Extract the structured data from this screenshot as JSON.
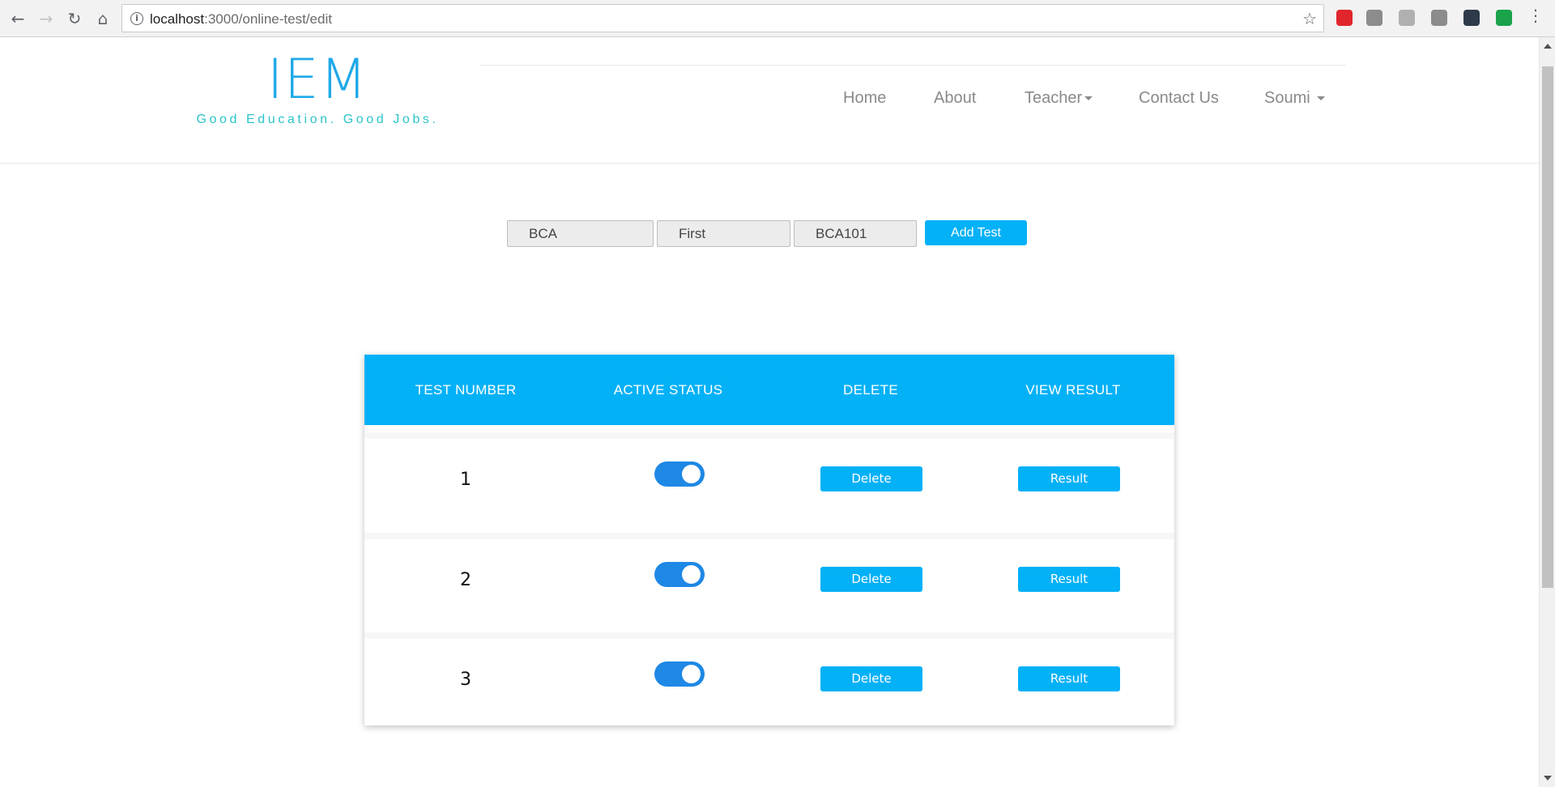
{
  "browser": {
    "url_host": "localhost",
    "url_path": ":3000/online-test/edit",
    "back_icon": "arrow-left-icon",
    "forward_icon": "arrow-right-icon",
    "reload_icon": "reload-icon",
    "home_icon": "home-icon",
    "extension_colors": [
      "#e0262b",
      "#8c8c8c",
      "#b0b0b0",
      "#8c8c8c",
      "#2e3a4a",
      "#1aa34a"
    ]
  },
  "header": {
    "brand": "IEM",
    "tagline": "Good Education. Good Jobs.",
    "nav": [
      {
        "label": "Home",
        "dropdown": false
      },
      {
        "label": "About",
        "dropdown": false
      },
      {
        "label": "Teacher",
        "dropdown": true
      },
      {
        "label": "Contact Us",
        "dropdown": false
      },
      {
        "label": "Soumi",
        "dropdown": true
      }
    ]
  },
  "form": {
    "course": "BCA",
    "semester": "First",
    "subject": "BCA101",
    "add_label": "Add Test"
  },
  "table": {
    "headers": [
      "TEST NUMBER",
      "ACTIVE STATUS",
      "DELETE",
      "VIEW RESULT"
    ],
    "rows": [
      {
        "number": "1",
        "active": true,
        "delete_label": "Delete",
        "result_label": "Result"
      },
      {
        "number": "2",
        "active": true,
        "delete_label": "Delete",
        "result_label": "Result"
      },
      {
        "number": "3",
        "active": true,
        "delete_label": "Delete",
        "result_label": "Result"
      }
    ]
  },
  "colors": {
    "accent": "#03b1f7",
    "brand": "#1fa9e8",
    "tagline": "#2bc4c9",
    "toggle_on": "#1e88e5"
  }
}
